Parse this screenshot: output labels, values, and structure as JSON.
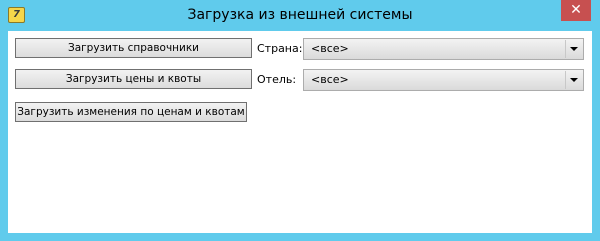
{
  "window": {
    "title": "Загрузка из внешней системы",
    "app_icon_glyph": "7",
    "close_glyph": "✕",
    "frame_color": "#60cbec",
    "close_color": "#c75050"
  },
  "buttons": {
    "load_references": "Загрузить справочники",
    "load_prices_quotas": "Загрузить цены и квоты",
    "load_changes": "Загрузить изменения по ценам и квотам"
  },
  "filters": {
    "country_label": "Страна:",
    "country_value": "<все>",
    "hotel_label": "Отель:",
    "hotel_value": "<все>"
  }
}
